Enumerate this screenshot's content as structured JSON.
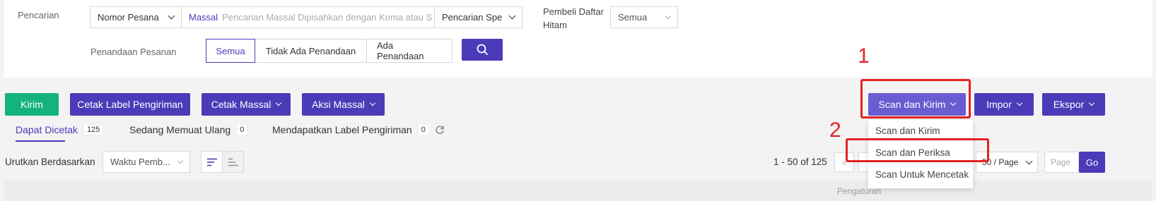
{
  "search": {
    "label": "Pencarian",
    "order_field": "Nomor Pesana",
    "massal_label": "Massal",
    "massal_placeholder": "Pencarian Massal Dipisahkan dengan Koma atau S",
    "special_search": "Pencarian Spe",
    "blacklist_label_1": "Pembeli Daftar",
    "blacklist_label_2": "Hitam",
    "blacklist_value": "Semua",
    "marking_label": "Penandaan Pesanan",
    "marking_options": [
      "Semua",
      "Tidak Ada Penandaan",
      "Ada Penandaan"
    ]
  },
  "toolbar": {
    "kirim": "Kirim",
    "cetak_label": "Cetak Label Pengiriman",
    "cetak_massal": "Cetak Massal",
    "aksi_massal": "Aksi Massal",
    "scan_kirim": "Scan dan Kirim",
    "impor": "Impor",
    "ekspor": "Ekspor"
  },
  "tabs": [
    {
      "label": "Dapat Dicetak",
      "count": "125"
    },
    {
      "label": "Sedang Memuat Ulang",
      "count": "0"
    },
    {
      "label": "Mendapatkan Label Pengiriman",
      "count": "0"
    }
  ],
  "sort": {
    "label": "Urutkan Berdasarkan",
    "value": "Waktu Pemb..."
  },
  "pagination": {
    "range": "1 - 50 of 125",
    "page_size": "50 / Page",
    "page_placeholder": "Page",
    "go": "Go"
  },
  "dropdown_menu": [
    "Scan dan Kirim",
    "Scan dan Periksa",
    "Scan Untuk Mencetak"
  ],
  "table": {
    "settings_header": "Pengaturan"
  },
  "annotations": {
    "one": "1",
    "two": "2"
  }
}
